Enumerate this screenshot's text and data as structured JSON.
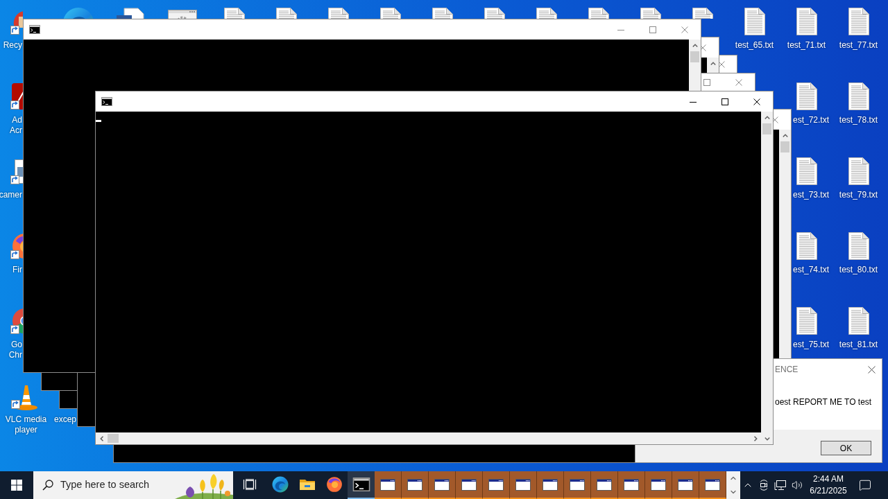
{
  "desktop": {
    "left_icons": [
      {
        "kind": "recycle-bin",
        "label": [
          "Recy"
        ]
      },
      {
        "kind": "acrobat",
        "label": [
          "Ad",
          "Acr"
        ]
      },
      {
        "kind": "image-file",
        "label": [
          "camer"
        ]
      },
      {
        "kind": "firefox",
        "label": [
          "Fir"
        ]
      },
      {
        "kind": "chrome",
        "label": [
          "Go",
          "Chr"
        ]
      },
      {
        "kind": "vlc",
        "label": [
          "VLC media",
          "player"
        ]
      }
    ],
    "partial_icons": [
      {
        "label": [
          "excep"
        ]
      }
    ],
    "file_columns": [
      [
        {
          "label": "test_65.txt"
        }
      ],
      [
        {
          "label": "test_71.txt"
        },
        {
          "label": "est_72.txt"
        },
        {
          "label": "est_73.txt"
        },
        {
          "label": "est_74.txt"
        },
        {
          "label": "est_75.txt"
        }
      ],
      [
        {
          "label": "test_77.txt"
        },
        {
          "label": "test_78.txt"
        },
        {
          "label": "test_79.txt"
        },
        {
          "label": "test_80.txt"
        },
        {
          "label": "test_81.txt"
        }
      ]
    ]
  },
  "windows": [
    {
      "kind": "console"
    },
    {
      "kind": "console"
    },
    {
      "kind": "console"
    },
    {
      "kind": "console"
    },
    {
      "kind": "console"
    },
    {
      "kind": "message_box",
      "title": "ENCE",
      "message": "oest REPORT ME TO test",
      "buttons": [
        "OK"
      ]
    },
    {
      "kind": "console",
      "cursor": true
    }
  ],
  "taskbar": {
    "search": {
      "placeholder": "Type here to search"
    },
    "pinned": [
      {
        "kind": "task-view",
        "active": false
      },
      {
        "kind": "edge",
        "active": false
      },
      {
        "kind": "file-explorer",
        "active": false
      },
      {
        "kind": "firefox",
        "active": false
      },
      {
        "kind": "console",
        "active": true
      }
    ],
    "window_buttons": [
      {
        "flashing": true
      },
      {
        "flashing": true
      },
      {
        "flashing": true
      },
      {
        "flashing": true
      },
      {
        "flashing": true
      },
      {
        "flashing": true
      },
      {
        "flashing": true
      },
      {
        "flashing": true
      },
      {
        "flashing": true
      },
      {
        "flashing": true
      },
      {
        "flashing": true
      },
      {
        "flashing": true
      },
      {
        "flashing": true
      }
    ],
    "clock": {
      "time": "2:44 AM",
      "date": "6/21/2025"
    }
  }
}
